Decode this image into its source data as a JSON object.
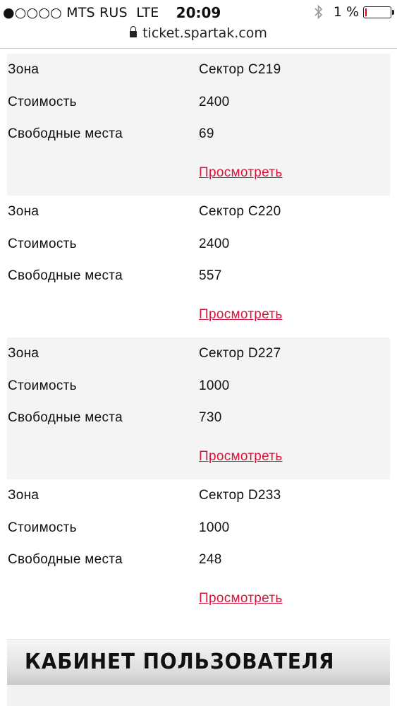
{
  "status_bar": {
    "carrier": "●○○○○ MTS RUS",
    "network": "LTE",
    "time": "20:09",
    "battery_text": "1 %",
    "battery_level_percent": 1
  },
  "browser": {
    "url": "ticket.spartak.com"
  },
  "labels": {
    "zone": "Зона",
    "price": "Стоимость",
    "free_seats": "Свободные места",
    "view": "Просмотреть"
  },
  "sectors": [
    {
      "zone": "Сектор C219",
      "price": "2400",
      "free_seats": "69"
    },
    {
      "zone": "Сектор C220",
      "price": "2400",
      "free_seats": "557"
    },
    {
      "zone": "Сектор D227",
      "price": "1000",
      "free_seats": "730"
    },
    {
      "zone": "Сектор D233",
      "price": "1000",
      "free_seats": "248"
    }
  ],
  "cabinet": {
    "title": "КАБИНЕТ ПОЛЬЗОВАТЕЛЯ"
  },
  "colors": {
    "link": "#d6163c",
    "battery_low": "#d0021b"
  }
}
